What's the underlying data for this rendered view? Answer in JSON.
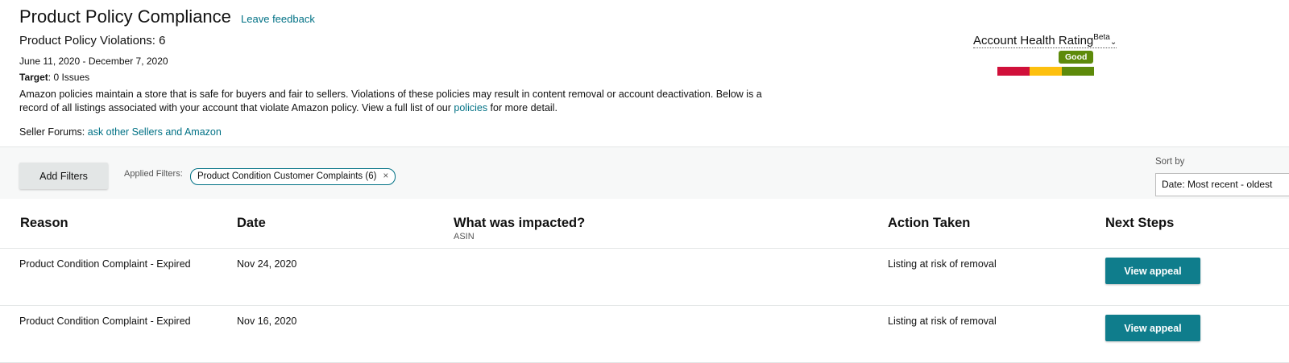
{
  "header": {
    "title": "Product Policy Compliance",
    "feedback_link": "Leave feedback",
    "violations": "Product Policy Violations: 6",
    "date_range": "June 11, 2020 - December 7, 2020",
    "target_label": "Target",
    "target_value": ": 0 Issues",
    "description_pre": "Amazon policies maintain a store that is safe for buyers and fair to sellers. Violations of these policies may result in content removal or account deactivation. Below is a record of all listings associated with your account that violate Amazon policy. View a full list of our ",
    "description_link": "policies",
    "description_post": " for more detail.",
    "forums_label": "Seller Forums: ",
    "forums_link": "ask other Sellers and Amazon"
  },
  "account_health": {
    "label": "Account Health Rating",
    "beta": "Beta",
    "chevron": "⌄",
    "status": "Good",
    "colors": [
      "#d0103a",
      "#fdc00f",
      "#5d8a0a"
    ]
  },
  "filters": {
    "add_button": "Add Filters",
    "applied_label": "Applied Filters:",
    "chip": "Product Condition Customer Complaints (6)",
    "chip_close": "×",
    "sort_label": "Sort by",
    "sort_value": "Date: Most recent - oldest"
  },
  "table": {
    "columns": {
      "reason": "Reason",
      "date": "Date",
      "impacted": "What was impacted?",
      "impacted_sub": "ASIN",
      "action": "Action Taken",
      "next": "Next Steps"
    },
    "rows": [
      {
        "reason": "Product Condition Complaint - Expired",
        "date": "Nov 24, 2020",
        "action": "Listing at risk of removal",
        "button": "View appeal"
      },
      {
        "reason": "Product Condition Complaint - Expired",
        "date": "Nov 16, 2020",
        "action": "Listing at risk of removal",
        "button": "View appeal"
      }
    ]
  }
}
